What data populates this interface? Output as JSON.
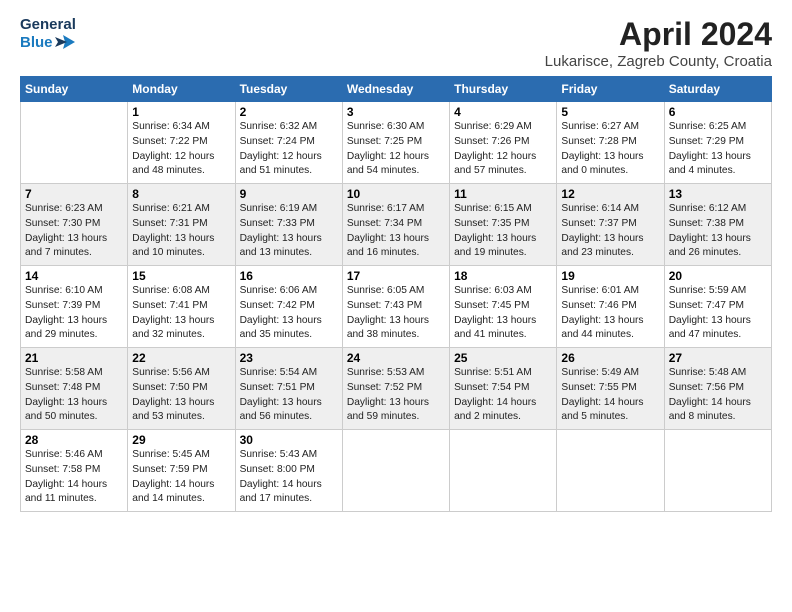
{
  "header": {
    "logo_line1": "General",
    "logo_line2": "Blue",
    "title": "April 2024",
    "subtitle": "Lukarisce, Zagreb County, Croatia"
  },
  "calendar": {
    "days_of_week": [
      "Sunday",
      "Monday",
      "Tuesday",
      "Wednesday",
      "Thursday",
      "Friday",
      "Saturday"
    ],
    "weeks": [
      {
        "cells": [
          {
            "day": "",
            "content": ""
          },
          {
            "day": "1",
            "content": "Sunrise: 6:34 AM\nSunset: 7:22 PM\nDaylight: 12 hours\nand 48 minutes."
          },
          {
            "day": "2",
            "content": "Sunrise: 6:32 AM\nSunset: 7:24 PM\nDaylight: 12 hours\nand 51 minutes."
          },
          {
            "day": "3",
            "content": "Sunrise: 6:30 AM\nSunset: 7:25 PM\nDaylight: 12 hours\nand 54 minutes."
          },
          {
            "day": "4",
            "content": "Sunrise: 6:29 AM\nSunset: 7:26 PM\nDaylight: 12 hours\nand 57 minutes."
          },
          {
            "day": "5",
            "content": "Sunrise: 6:27 AM\nSunset: 7:28 PM\nDaylight: 13 hours\nand 0 minutes."
          },
          {
            "day": "6",
            "content": "Sunrise: 6:25 AM\nSunset: 7:29 PM\nDaylight: 13 hours\nand 4 minutes."
          }
        ]
      },
      {
        "cells": [
          {
            "day": "7",
            "content": "Sunrise: 6:23 AM\nSunset: 7:30 PM\nDaylight: 13 hours\nand 7 minutes."
          },
          {
            "day": "8",
            "content": "Sunrise: 6:21 AM\nSunset: 7:31 PM\nDaylight: 13 hours\nand 10 minutes."
          },
          {
            "day": "9",
            "content": "Sunrise: 6:19 AM\nSunset: 7:33 PM\nDaylight: 13 hours\nand 13 minutes."
          },
          {
            "day": "10",
            "content": "Sunrise: 6:17 AM\nSunset: 7:34 PM\nDaylight: 13 hours\nand 16 minutes."
          },
          {
            "day": "11",
            "content": "Sunrise: 6:15 AM\nSunset: 7:35 PM\nDaylight: 13 hours\nand 19 minutes."
          },
          {
            "day": "12",
            "content": "Sunrise: 6:14 AM\nSunset: 7:37 PM\nDaylight: 13 hours\nand 23 minutes."
          },
          {
            "day": "13",
            "content": "Sunrise: 6:12 AM\nSunset: 7:38 PM\nDaylight: 13 hours\nand 26 minutes."
          }
        ]
      },
      {
        "cells": [
          {
            "day": "14",
            "content": "Sunrise: 6:10 AM\nSunset: 7:39 PM\nDaylight: 13 hours\nand 29 minutes."
          },
          {
            "day": "15",
            "content": "Sunrise: 6:08 AM\nSunset: 7:41 PM\nDaylight: 13 hours\nand 32 minutes."
          },
          {
            "day": "16",
            "content": "Sunrise: 6:06 AM\nSunset: 7:42 PM\nDaylight: 13 hours\nand 35 minutes."
          },
          {
            "day": "17",
            "content": "Sunrise: 6:05 AM\nSunset: 7:43 PM\nDaylight: 13 hours\nand 38 minutes."
          },
          {
            "day": "18",
            "content": "Sunrise: 6:03 AM\nSunset: 7:45 PM\nDaylight: 13 hours\nand 41 minutes."
          },
          {
            "day": "19",
            "content": "Sunrise: 6:01 AM\nSunset: 7:46 PM\nDaylight: 13 hours\nand 44 minutes."
          },
          {
            "day": "20",
            "content": "Sunrise: 5:59 AM\nSunset: 7:47 PM\nDaylight: 13 hours\nand 47 minutes."
          }
        ]
      },
      {
        "cells": [
          {
            "day": "21",
            "content": "Sunrise: 5:58 AM\nSunset: 7:48 PM\nDaylight: 13 hours\nand 50 minutes."
          },
          {
            "day": "22",
            "content": "Sunrise: 5:56 AM\nSunset: 7:50 PM\nDaylight: 13 hours\nand 53 minutes."
          },
          {
            "day": "23",
            "content": "Sunrise: 5:54 AM\nSunset: 7:51 PM\nDaylight: 13 hours\nand 56 minutes."
          },
          {
            "day": "24",
            "content": "Sunrise: 5:53 AM\nSunset: 7:52 PM\nDaylight: 13 hours\nand 59 minutes."
          },
          {
            "day": "25",
            "content": "Sunrise: 5:51 AM\nSunset: 7:54 PM\nDaylight: 14 hours\nand 2 minutes."
          },
          {
            "day": "26",
            "content": "Sunrise: 5:49 AM\nSunset: 7:55 PM\nDaylight: 14 hours\nand 5 minutes."
          },
          {
            "day": "27",
            "content": "Sunrise: 5:48 AM\nSunset: 7:56 PM\nDaylight: 14 hours\nand 8 minutes."
          }
        ]
      },
      {
        "cells": [
          {
            "day": "28",
            "content": "Sunrise: 5:46 AM\nSunset: 7:58 PM\nDaylight: 14 hours\nand 11 minutes."
          },
          {
            "day": "29",
            "content": "Sunrise: 5:45 AM\nSunset: 7:59 PM\nDaylight: 14 hours\nand 14 minutes."
          },
          {
            "day": "30",
            "content": "Sunrise: 5:43 AM\nSunset: 8:00 PM\nDaylight: 14 hours\nand 17 minutes."
          },
          {
            "day": "",
            "content": ""
          },
          {
            "day": "",
            "content": ""
          },
          {
            "day": "",
            "content": ""
          },
          {
            "day": "",
            "content": ""
          }
        ]
      }
    ]
  }
}
